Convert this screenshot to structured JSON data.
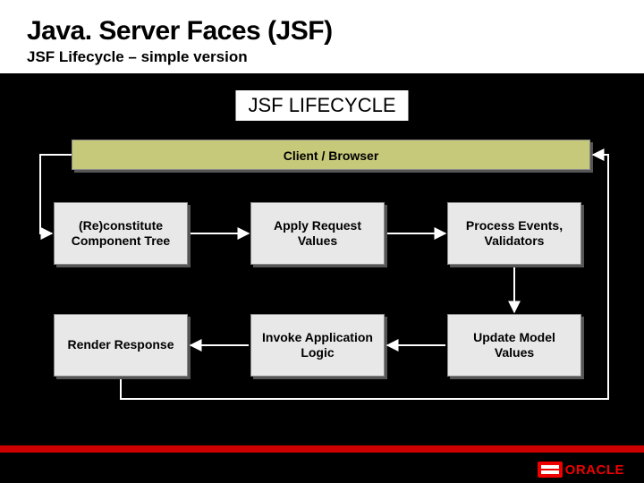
{
  "header": {
    "title": "Java. Server Faces (JSF)",
    "subtitle": "JSF Lifecycle – simple version"
  },
  "diagram": {
    "title": "JSF LIFECYCLE",
    "client": "Client / Browser",
    "phases": {
      "reconstitute": "(Re)constitute Component Tree",
      "apply": "Apply Request Values",
      "process": "Process Events, Validators",
      "render": "Render Response",
      "invoke": "Invoke Application Logic",
      "update": "Update Model Values"
    }
  },
  "footer": {
    "brand": "ORACLE"
  },
  "chart_data": {
    "type": "diagram",
    "title": "JSF LIFECYCLE",
    "nodes": [
      {
        "id": "client",
        "label": "Client / Browser"
      },
      {
        "id": "reconstitute",
        "label": "(Re)constitute Component Tree"
      },
      {
        "id": "apply",
        "label": "Apply Request Values"
      },
      {
        "id": "process",
        "label": "Process Events, Validators"
      },
      {
        "id": "update",
        "label": "Update Model Values"
      },
      {
        "id": "invoke",
        "label": "Invoke Application Logic"
      },
      {
        "id": "render",
        "label": "Render Response"
      }
    ],
    "edges": [
      {
        "from": "client",
        "to": "reconstitute"
      },
      {
        "from": "reconstitute",
        "to": "apply"
      },
      {
        "from": "apply",
        "to": "process"
      },
      {
        "from": "process",
        "to": "update"
      },
      {
        "from": "update",
        "to": "invoke"
      },
      {
        "from": "invoke",
        "to": "render"
      },
      {
        "from": "render",
        "to": "client"
      }
    ]
  }
}
